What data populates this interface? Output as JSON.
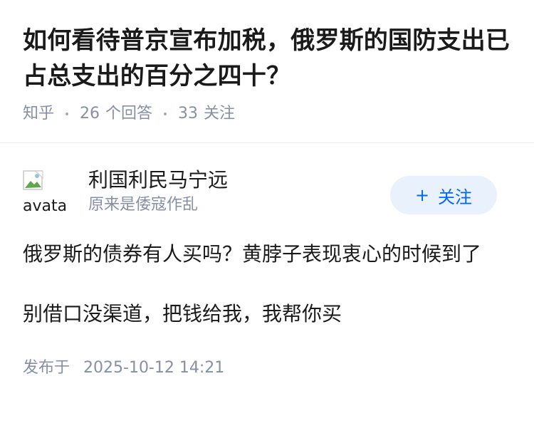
{
  "question": {
    "title": "如何看待普京宣布加税，俄罗斯的国防支出已占总支出的百分之四十？",
    "source": "知乎",
    "answer_count": "26",
    "answer_label": "个回答",
    "follow_count": "33",
    "follow_label": "关注"
  },
  "answer": {
    "author": {
      "avatar_alt": "avatar",
      "name": "利国利民马宁远",
      "bio": "原来是倭寇作乱"
    },
    "follow_button": {
      "plus": "+",
      "label": "关注"
    },
    "paragraphs": [
      "俄罗斯的债券有人买吗？黄脖子表现衷心的时候到了",
      "别借口没渠道，把钱给我，我帮你买"
    ],
    "publish_label": "发布于",
    "publish_time": "2025-10-12 14:21"
  },
  "colors": {
    "accent": "#0066ff",
    "follow_bg": "#e8f1fc",
    "meta_text": "#8590a6",
    "body_text": "#1a1a1a"
  },
  "icons": {
    "avatar": "broken-image-icon"
  }
}
